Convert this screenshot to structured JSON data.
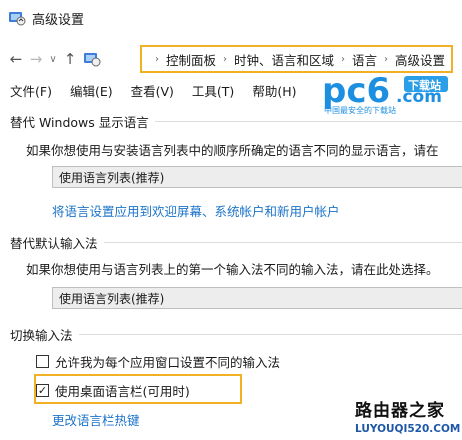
{
  "window": {
    "title": "高级设置"
  },
  "nav": {
    "back": "←",
    "forward": "→",
    "recent": "∨",
    "up": "↑",
    "breadcrumb": [
      "控制面板",
      "时钟、语言和区域",
      "语言",
      "高级设置"
    ],
    "separator": "›"
  },
  "menu": [
    "文件(F)",
    "编辑(E)",
    "查看(V)",
    "工具(T)",
    "帮助(H)"
  ],
  "sections": {
    "display_language": {
      "title": "替代 Windows 显示语言",
      "description": "如果你想使用与安装语言列表中的顺序所确定的语言不同的显示语言，请在",
      "dropdown_value": "使用语言列表(推荐)",
      "link": "将语言设置应用到欢迎屏幕、系统帐户和新用户帐户"
    },
    "input_method": {
      "title": "替代默认输入法",
      "description": "如果你想使用与语言列表上的第一个输入法不同的输入法，请在此处选择。",
      "dropdown_value": "使用语言列表(推荐)"
    },
    "switch_input": {
      "title": "切换输入法",
      "option_per_app": {
        "label": "允许我为每个应用窗口设置不同的输入法",
        "checked": false
      },
      "option_language_bar": {
        "label": "使用桌面语言栏(可用时)",
        "checked": true
      },
      "link": "更改语言栏热键"
    }
  },
  "check_mark": "✓",
  "logo": {
    "text": "pc6",
    "suffix": ".com",
    "badge": "下载站",
    "tagline": "中国最安全的下载站"
  },
  "watermark": {
    "title": "路由器之家",
    "subtitle": "LUYOUQI520.COM"
  },
  "colors": {
    "highlight": "#f2b124",
    "link": "#1b73c9",
    "logo_blue": "#1d8fe0"
  }
}
